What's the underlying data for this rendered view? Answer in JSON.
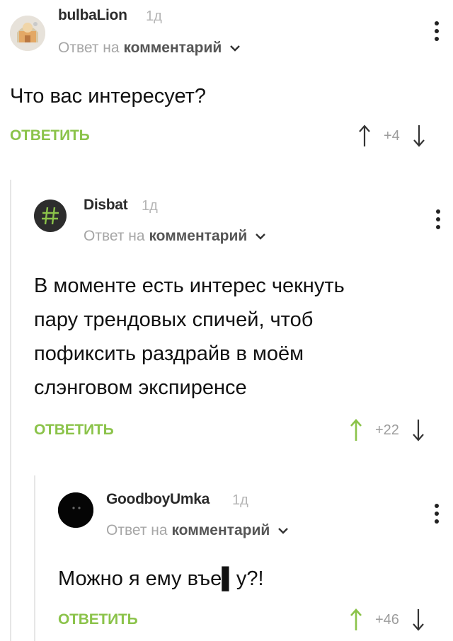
{
  "comments": [
    {
      "username": "bulbaLion",
      "time": "1д",
      "reply_prefix": "Ответ на",
      "reply_link": "комментарий",
      "text_lines": [
        "Что вас интересует?"
      ],
      "reply_button": "ОТВЕТИТЬ",
      "rating": "+4",
      "avatar_icon": "lion-avatar-icon"
    },
    {
      "username": "Disbat",
      "time": "1д",
      "reply_prefix": "Ответ на",
      "reply_link": "комментарий",
      "text_lines": [
        "В моменте есть интерес чекнуть",
        "пару трендовых спичей, чтоб",
        "пофиксить раздрайв в моём",
        "слэнговом экспиренсе"
      ],
      "reply_button": "ОТВЕТИТЬ",
      "rating": "+22",
      "avatar_icon": "hash-avatar-icon",
      "avatar_glyph": "#"
    },
    {
      "username": "GoodboyUmka",
      "time": "1д",
      "reply_prefix": "Ответ на",
      "reply_link": "комментарий",
      "text_lines": [
        "Можно я ему въе▌у?!"
      ],
      "reply_button": "ОТВЕТИТЬ",
      "rating": "+46",
      "avatar_icon": "black-cat-avatar-icon"
    }
  ],
  "colors": {
    "accent_green": "#8bc34a",
    "avatar_dark": "#2d2d2d",
    "hash_green": "#8bc34a"
  }
}
